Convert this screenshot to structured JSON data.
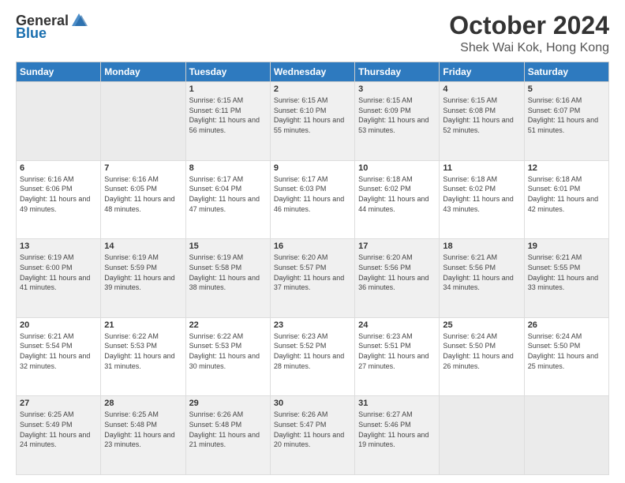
{
  "logo": {
    "general": "General",
    "blue": "Blue"
  },
  "title": "October 2024",
  "location": "Shek Wai Kok, Hong Kong",
  "weekdays": [
    "Sunday",
    "Monday",
    "Tuesday",
    "Wednesday",
    "Thursday",
    "Friday",
    "Saturday"
  ],
  "weeks": [
    [
      {
        "day": "",
        "empty": true
      },
      {
        "day": "",
        "empty": true
      },
      {
        "day": "1",
        "sunrise": "Sunrise: 6:15 AM",
        "sunset": "Sunset: 6:11 PM",
        "daylight": "Daylight: 11 hours and 56 minutes."
      },
      {
        "day": "2",
        "sunrise": "Sunrise: 6:15 AM",
        "sunset": "Sunset: 6:10 PM",
        "daylight": "Daylight: 11 hours and 55 minutes."
      },
      {
        "day": "3",
        "sunrise": "Sunrise: 6:15 AM",
        "sunset": "Sunset: 6:09 PM",
        "daylight": "Daylight: 11 hours and 53 minutes."
      },
      {
        "day": "4",
        "sunrise": "Sunrise: 6:15 AM",
        "sunset": "Sunset: 6:08 PM",
        "daylight": "Daylight: 11 hours and 52 minutes."
      },
      {
        "day": "5",
        "sunrise": "Sunrise: 6:16 AM",
        "sunset": "Sunset: 6:07 PM",
        "daylight": "Daylight: 11 hours and 51 minutes."
      }
    ],
    [
      {
        "day": "6",
        "sunrise": "Sunrise: 6:16 AM",
        "sunset": "Sunset: 6:06 PM",
        "daylight": "Daylight: 11 hours and 49 minutes."
      },
      {
        "day": "7",
        "sunrise": "Sunrise: 6:16 AM",
        "sunset": "Sunset: 6:05 PM",
        "daylight": "Daylight: 11 hours and 48 minutes."
      },
      {
        "day": "8",
        "sunrise": "Sunrise: 6:17 AM",
        "sunset": "Sunset: 6:04 PM",
        "daylight": "Daylight: 11 hours and 47 minutes."
      },
      {
        "day": "9",
        "sunrise": "Sunrise: 6:17 AM",
        "sunset": "Sunset: 6:03 PM",
        "daylight": "Daylight: 11 hours and 46 minutes."
      },
      {
        "day": "10",
        "sunrise": "Sunrise: 6:18 AM",
        "sunset": "Sunset: 6:02 PM",
        "daylight": "Daylight: 11 hours and 44 minutes."
      },
      {
        "day": "11",
        "sunrise": "Sunrise: 6:18 AM",
        "sunset": "Sunset: 6:02 PM",
        "daylight": "Daylight: 11 hours and 43 minutes."
      },
      {
        "day": "12",
        "sunrise": "Sunrise: 6:18 AM",
        "sunset": "Sunset: 6:01 PM",
        "daylight": "Daylight: 11 hours and 42 minutes."
      }
    ],
    [
      {
        "day": "13",
        "sunrise": "Sunrise: 6:19 AM",
        "sunset": "Sunset: 6:00 PM",
        "daylight": "Daylight: 11 hours and 41 minutes."
      },
      {
        "day": "14",
        "sunrise": "Sunrise: 6:19 AM",
        "sunset": "Sunset: 5:59 PM",
        "daylight": "Daylight: 11 hours and 39 minutes."
      },
      {
        "day": "15",
        "sunrise": "Sunrise: 6:19 AM",
        "sunset": "Sunset: 5:58 PM",
        "daylight": "Daylight: 11 hours and 38 minutes."
      },
      {
        "day": "16",
        "sunrise": "Sunrise: 6:20 AM",
        "sunset": "Sunset: 5:57 PM",
        "daylight": "Daylight: 11 hours and 37 minutes."
      },
      {
        "day": "17",
        "sunrise": "Sunrise: 6:20 AM",
        "sunset": "Sunset: 5:56 PM",
        "daylight": "Daylight: 11 hours and 36 minutes."
      },
      {
        "day": "18",
        "sunrise": "Sunrise: 6:21 AM",
        "sunset": "Sunset: 5:56 PM",
        "daylight": "Daylight: 11 hours and 34 minutes."
      },
      {
        "day": "19",
        "sunrise": "Sunrise: 6:21 AM",
        "sunset": "Sunset: 5:55 PM",
        "daylight": "Daylight: 11 hours and 33 minutes."
      }
    ],
    [
      {
        "day": "20",
        "sunrise": "Sunrise: 6:21 AM",
        "sunset": "Sunset: 5:54 PM",
        "daylight": "Daylight: 11 hours and 32 minutes."
      },
      {
        "day": "21",
        "sunrise": "Sunrise: 6:22 AM",
        "sunset": "Sunset: 5:53 PM",
        "daylight": "Daylight: 11 hours and 31 minutes."
      },
      {
        "day": "22",
        "sunrise": "Sunrise: 6:22 AM",
        "sunset": "Sunset: 5:53 PM",
        "daylight": "Daylight: 11 hours and 30 minutes."
      },
      {
        "day": "23",
        "sunrise": "Sunrise: 6:23 AM",
        "sunset": "Sunset: 5:52 PM",
        "daylight": "Daylight: 11 hours and 28 minutes."
      },
      {
        "day": "24",
        "sunrise": "Sunrise: 6:23 AM",
        "sunset": "Sunset: 5:51 PM",
        "daylight": "Daylight: 11 hours and 27 minutes."
      },
      {
        "day": "25",
        "sunrise": "Sunrise: 6:24 AM",
        "sunset": "Sunset: 5:50 PM",
        "daylight": "Daylight: 11 hours and 26 minutes."
      },
      {
        "day": "26",
        "sunrise": "Sunrise: 6:24 AM",
        "sunset": "Sunset: 5:50 PM",
        "daylight": "Daylight: 11 hours and 25 minutes."
      }
    ],
    [
      {
        "day": "27",
        "sunrise": "Sunrise: 6:25 AM",
        "sunset": "Sunset: 5:49 PM",
        "daylight": "Daylight: 11 hours and 24 minutes."
      },
      {
        "day": "28",
        "sunrise": "Sunrise: 6:25 AM",
        "sunset": "Sunset: 5:48 PM",
        "daylight": "Daylight: 11 hours and 23 minutes."
      },
      {
        "day": "29",
        "sunrise": "Sunrise: 6:26 AM",
        "sunset": "Sunset: 5:48 PM",
        "daylight": "Daylight: 11 hours and 21 minutes."
      },
      {
        "day": "30",
        "sunrise": "Sunrise: 6:26 AM",
        "sunset": "Sunset: 5:47 PM",
        "daylight": "Daylight: 11 hours and 20 minutes."
      },
      {
        "day": "31",
        "sunrise": "Sunrise: 6:27 AM",
        "sunset": "Sunset: 5:46 PM",
        "daylight": "Daylight: 11 hours and 19 minutes."
      },
      {
        "day": "",
        "empty": true
      },
      {
        "day": "",
        "empty": true
      }
    ]
  ]
}
